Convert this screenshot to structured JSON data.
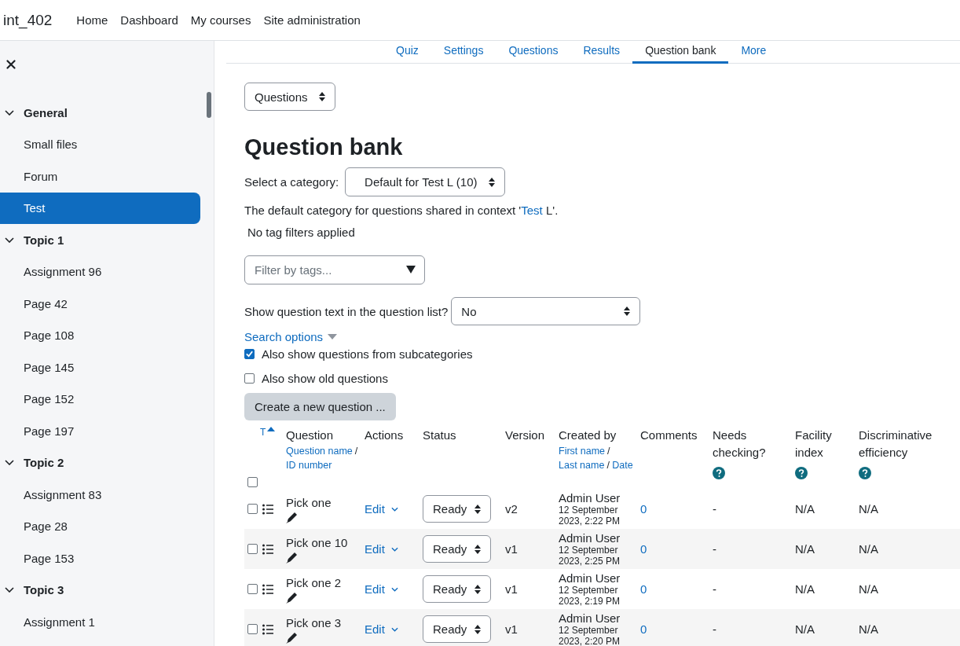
{
  "site_name": "int_402",
  "nav": [
    {
      "label": "Home"
    },
    {
      "label": "Dashboard"
    },
    {
      "label": "My courses"
    },
    {
      "label": "Site administration"
    }
  ],
  "sidebar": {
    "sections": [
      {
        "title": "General",
        "expanded": true,
        "children": [
          {
            "label": "Small files",
            "selected": false
          },
          {
            "label": "Forum",
            "selected": false
          },
          {
            "label": "Test",
            "selected": true
          }
        ]
      },
      {
        "title": "Topic 1",
        "expanded": true,
        "children": [
          {
            "label": "Assignment 96",
            "selected": false
          },
          {
            "label": "Page 42",
            "selected": false
          },
          {
            "label": "Page 108",
            "selected": false
          },
          {
            "label": "Page 145",
            "selected": false
          },
          {
            "label": "Page 152",
            "selected": false
          },
          {
            "label": "Page 197",
            "selected": false
          }
        ]
      },
      {
        "title": "Topic 2",
        "expanded": true,
        "children": [
          {
            "label": "Assignment 83",
            "selected": false
          },
          {
            "label": "Page 28",
            "selected": false
          },
          {
            "label": "Page 153",
            "selected": false
          }
        ]
      },
      {
        "title": "Topic 3",
        "expanded": true,
        "children": [
          {
            "label": "Assignment 1",
            "selected": false
          }
        ]
      }
    ]
  },
  "tabs": [
    {
      "label": "Quiz",
      "selected": false
    },
    {
      "label": "Settings",
      "selected": false
    },
    {
      "label": "Questions",
      "selected": false
    },
    {
      "label": "Results",
      "selected": false
    },
    {
      "label": "Question bank",
      "selected": true
    },
    {
      "label": "More",
      "selected": false
    }
  ],
  "page_select": "Questions",
  "heading": "Question bank",
  "category": {
    "label": "Select a category:",
    "value": "Default for Test L (10)"
  },
  "context_note": {
    "before": "The default category for questions shared in context '",
    "link": "Test",
    "after": " L'."
  },
  "tag_note": "No tag filters applied",
  "tag_filter": {
    "placeholder": "Filter by tags..."
  },
  "show_text": {
    "label": "Show question text in the question list?",
    "value": "No"
  },
  "search_options": "Search options",
  "options": [
    {
      "label": "Also show questions from subcategories",
      "checked": true
    },
    {
      "label": "Also show old questions",
      "checked": false
    }
  ],
  "create_button": "Create a new question ...",
  "table": {
    "select_all_checked": false,
    "columns": [
      {
        "kind": "type",
        "label": "T",
        "sorted": true
      },
      {
        "kind": "sortable",
        "label": "Question",
        "links": [
          "Question name",
          "ID number"
        ],
        "separator": "/"
      },
      {
        "kind": "plain",
        "label": "Actions"
      },
      {
        "kind": "plain",
        "label": "Status"
      },
      {
        "kind": "plain",
        "label": "Version"
      },
      {
        "kind": "sortable",
        "label": "Created by",
        "links": [
          "First name",
          "Last name",
          "Date"
        ],
        "separator": "/"
      },
      {
        "kind": "plain",
        "label": "Comments"
      },
      {
        "kind": "help",
        "label": "Needs checking?"
      },
      {
        "kind": "help",
        "label": "Facility index"
      },
      {
        "kind": "help",
        "label": "Discriminative efficiency"
      }
    ],
    "rows": [
      {
        "checked": false,
        "name": "Pick one",
        "action": "Edit",
        "status": "Ready",
        "version": "v2",
        "creator": "Admin User",
        "date": "12 September 2023, 2:22 PM",
        "comments": "0",
        "needs_checking": "-",
        "facility": "N/A",
        "discrimination": "N/A"
      },
      {
        "checked": false,
        "name": "Pick one 10",
        "action": "Edit",
        "status": "Ready",
        "version": "v1",
        "creator": "Admin User",
        "date": "12 September 2023, 2:25 PM",
        "comments": "0",
        "needs_checking": "-",
        "facility": "N/A",
        "discrimination": "N/A"
      },
      {
        "checked": false,
        "name": "Pick one 2",
        "action": "Edit",
        "status": "Ready",
        "version": "v1",
        "creator": "Admin User",
        "date": "12 September 2023, 2:19 PM",
        "comments": "0",
        "needs_checking": "-",
        "facility": "N/A",
        "discrimination": "N/A"
      },
      {
        "checked": false,
        "name": "Pick one 3",
        "action": "Edit",
        "status": "Ready",
        "version": "v1",
        "creator": "Admin User",
        "date": "12 September 2023, 2:20 PM",
        "comments": "0",
        "needs_checking": "-",
        "facility": "N/A",
        "discrimination": "N/A"
      }
    ]
  }
}
